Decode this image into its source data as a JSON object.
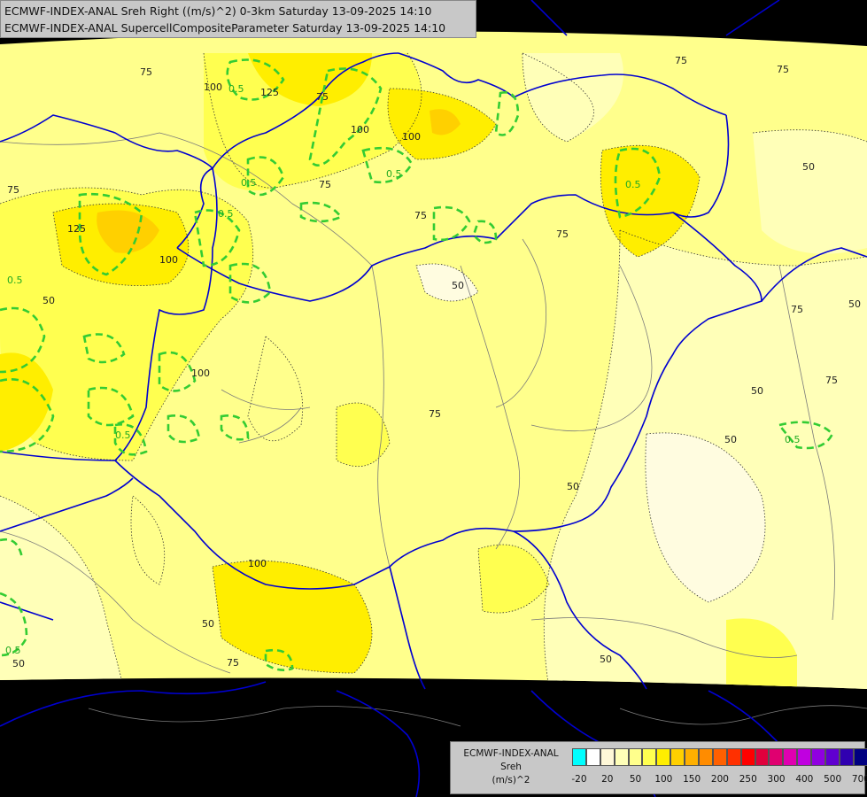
{
  "header": {
    "line1": "ECMWF-INDEX-ANAL Sreh Right ((m/s)^2) 0-3km Saturday 13-09-2025 14:10",
    "line2": "ECMWF-INDEX-ANAL SupercellCompositeParameter Saturday 13-09-2025 14:10"
  },
  "legend": {
    "line1": "ECMWF-INDEX-ANAL",
    "line2": "Sreh",
    "line3": "(m/s)^2",
    "colors": [
      "#00ffff",
      "#ffffff",
      "#fff8d8",
      "#ffffb8",
      "#ffff8c",
      "#ffff50",
      "#ffee00",
      "#ffd000",
      "#ffb000",
      "#ff8c00",
      "#ff6000",
      "#ff3000",
      "#ff0000",
      "#e0003c",
      "#e00070",
      "#e000b0",
      "#c000e0",
      "#9000e0",
      "#6000d0",
      "#3000b0",
      "#000080"
    ],
    "ticks": [
      "-20",
      "20",
      "50",
      "100",
      "150",
      "200",
      "250",
      "300",
      "400",
      "500",
      "700"
    ]
  },
  "map_labels": {
    "srh": [
      "75",
      "100",
      "125",
      "75",
      "100",
      "75",
      "75",
      "125",
      "100",
      "50",
      "75",
      "50",
      "100",
      "75",
      "75",
      "50",
      "75",
      "50",
      "75",
      "100",
      "50",
      "75",
      "100",
      "50",
      "50",
      "75",
      "50",
      "75",
      "50",
      "50"
    ],
    "scp": [
      "0.5",
      "0.5",
      "0.5",
      "0.5",
      "0.5",
      "0.5",
      "0.5",
      "0.5",
      "0.5"
    ]
  },
  "colors": {
    "background": "#000000",
    "border": "#0000d0",
    "scp_contour": "#33cc33",
    "srh_fill_light": "#ffffb8",
    "srh_fill_mid": "#ffff50",
    "srh_fill_high": "#ffee00",
    "srh_fill_peak": "#ffd000"
  }
}
